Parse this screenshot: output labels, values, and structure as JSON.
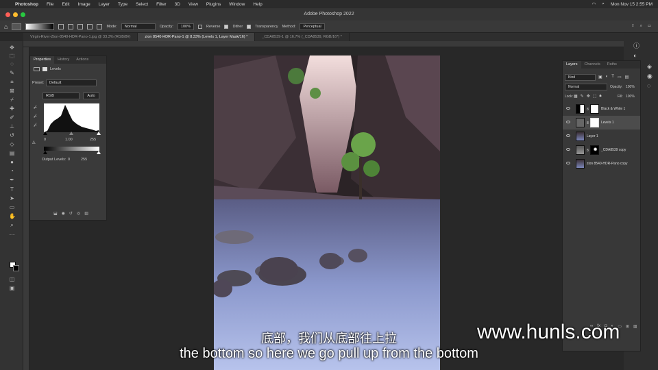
{
  "menubar": {
    "app": "Photoshop",
    "items": [
      "File",
      "Edit",
      "Image",
      "Layer",
      "Type",
      "Select",
      "Filter",
      "3D",
      "View",
      "Plugins",
      "Window",
      "Help"
    ],
    "clock": "Mon Nov 15  2:55 PM"
  },
  "window_title": "Adobe Photoshop 2022",
  "options": {
    "mode_label": "Mode:",
    "mode_value": "Normal",
    "opacity_label": "Opacity:",
    "opacity_value": "100%",
    "reverse_label": "Reverse",
    "dither_label": "Dither",
    "transparency_label": "Transparency",
    "method_label": "Method:",
    "method_value": "Perceptual"
  },
  "doc_tabs": [
    {
      "label": "Virgin-River-Zion-8540-HDR-Pano-1.jpg @ 33.3% (RGB/8#)"
    },
    {
      "label": "zion 8540-HDR-Pano-1 @ 8.33% (Levels 1, Layer Mask/16) *"
    },
    {
      "label": "_CDA8539-1 @ 16.7% (_CDA8539, RGB/16*) *"
    }
  ],
  "properties": {
    "tabs": [
      "Properties",
      "History",
      "Actions"
    ],
    "type_label": "Levels",
    "preset_label": "Preset:",
    "preset_value": "Default",
    "channel": "RGB",
    "auto_label": "Auto",
    "input_black": "0",
    "input_mid": "1.00",
    "input_white": "255",
    "output_label": "Output Levels:",
    "output_black": "0",
    "output_white": "255"
  },
  "layers_panel": {
    "tabs": [
      "Layers",
      "Channels",
      "Paths"
    ],
    "kind_label": "Kind",
    "blend": "Normal",
    "opacity_label": "Opacity:",
    "opacity_value": "100%",
    "lock_label": "Lock:",
    "fill_label": "Fill:",
    "fill_value": "100%",
    "layers": [
      {
        "name": "Black & White 1"
      },
      {
        "name": "Levels 1"
      },
      {
        "name": "Layer 1"
      },
      {
        "name": "_CDA8539 copy"
      },
      {
        "name": "zion 8540-HDR-Pano copy"
      }
    ]
  },
  "subtitle_cn": "底部，我们从底部往上拉",
  "subtitle_en": "the bottom so here we go pull up from the bottom",
  "watermark": "www.hunls.com",
  "colors": {
    "accent": "#4a89dc",
    "panel": "#383838",
    "bg": "#282828"
  }
}
